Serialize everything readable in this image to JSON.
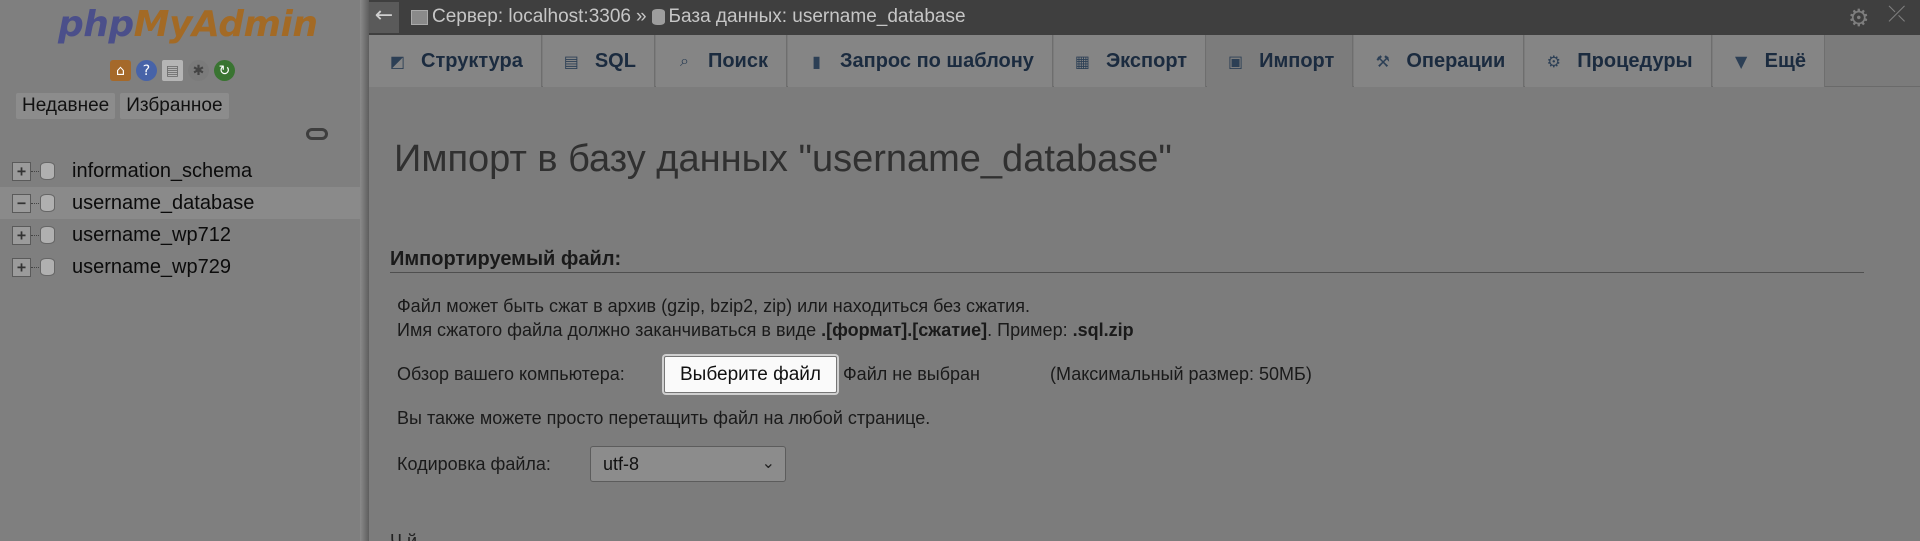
{
  "logo": {
    "part1": "php",
    "part2": "MyAdmin"
  },
  "nav": {
    "icons": [
      "home-icon",
      "help-icon",
      "docs-icon",
      "settings-icon",
      "reload-icon"
    ],
    "buttons": {
      "recent": "Недавнее",
      "favorites": "Избранное"
    },
    "databases": [
      {
        "name": "information_schema",
        "expander": "+"
      },
      {
        "name": "username_database",
        "expander": "−"
      },
      {
        "name": "username_wp712",
        "expander": "+"
      },
      {
        "name": "username_wp729",
        "expander": "+"
      }
    ]
  },
  "topbar": {
    "back": "←",
    "server": "Сервер: localhost:3306",
    "separator": "»",
    "database": "База данных: username_database"
  },
  "tabs": [
    {
      "label": "Структура",
      "icon": "structure-icon"
    },
    {
      "label": "SQL",
      "icon": "sql-icon"
    },
    {
      "label": "Поиск",
      "icon": "search-icon"
    },
    {
      "label": "Запрос по шаблону",
      "icon": "query-icon"
    },
    {
      "label": "Экспорт",
      "icon": "export-icon"
    },
    {
      "label": "Импорт",
      "icon": "import-icon",
      "active": true
    },
    {
      "label": "Операции",
      "icon": "wrench-icon"
    },
    {
      "label": "Процедуры",
      "icon": "routines-icon"
    },
    {
      "label": "Ещё",
      "icon": "dropdown-icon"
    }
  ],
  "main": {
    "title": "Импорт в базу данных \"username_database\"",
    "section_title": "Импортируемый файл:",
    "note_line1": "Файл может быть сжат в архив (gzip, bzip2, zip) или находиться без сжатия.",
    "note_line2_a": "Имя сжатого файла должно заканчиваться в виде ",
    "note_line2_b": ".[формат].[сжатие]",
    "note_line2_c": ". Пример: ",
    "note_line2_d": ".sql.zip",
    "browse_label": "Обзор вашего компьютера:",
    "choose_file_button": "Выберите файл",
    "no_file": "Файл не выбран",
    "max_size": "(Максимальный размер: 50МБ)",
    "drag_note": "Вы также можете просто перетащить файл на любой странице.",
    "encoding_label": "Кодировка файла:",
    "encoding_value": "utf-8",
    "cut_text": "Ч                 й"
  }
}
